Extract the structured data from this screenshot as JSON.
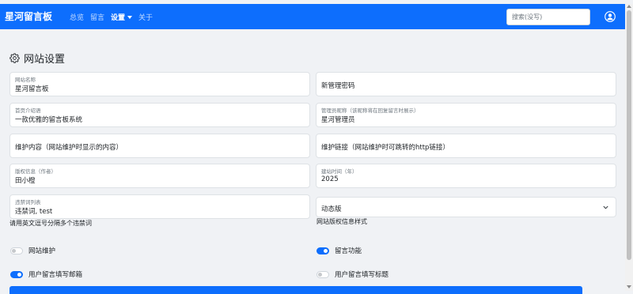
{
  "navbar": {
    "brand": "星河留言板",
    "links": [
      {
        "label": "总览"
      },
      {
        "label": "留言"
      },
      {
        "label": "设置"
      },
      {
        "label": "关于"
      }
    ],
    "search_placeholder": "搜索(没写)",
    "accent_color": "#0d6efd"
  },
  "page": {
    "title": "网站设置",
    "title_icon": "gear-icon"
  },
  "fields": {
    "site_name": {
      "label": "网站名称",
      "value": "星河留言板"
    },
    "new_password": {
      "placeholder": "新管理密码"
    },
    "home_intro": {
      "label": "首页介绍语",
      "value": "一款优雅的留言板系统"
    },
    "admin_nickname": {
      "label": "管理员昵称（该昵称将在回复留言时展示）",
      "value": "星河管理员"
    },
    "maintenance_content": {
      "placeholder": "维护内容（网站维护时显示的内容）"
    },
    "maintenance_link": {
      "placeholder": "维护链接（网站维护时可跳转的http链接）"
    },
    "copyright": {
      "label": "版权信息（作者）",
      "value": "田小橙"
    },
    "build_year": {
      "label": "建站时间（年）",
      "value": "2025"
    },
    "banned_words": {
      "label": "违禁词列表",
      "value": "违禁词, test",
      "help": "请用英文逗号分隔多个违禁词"
    },
    "copyright_style": {
      "selected": "动态版",
      "help": "网站版权信息样式"
    }
  },
  "toggles": {
    "site_maintenance": {
      "label": "网站维护",
      "on": false
    },
    "comment_enabled": {
      "label": "留言功能",
      "on": true
    },
    "require_email": {
      "label": "用户留言填写邮箱",
      "on": true
    },
    "require_title": {
      "label": "用户留言填写标题",
      "on": false
    }
  }
}
